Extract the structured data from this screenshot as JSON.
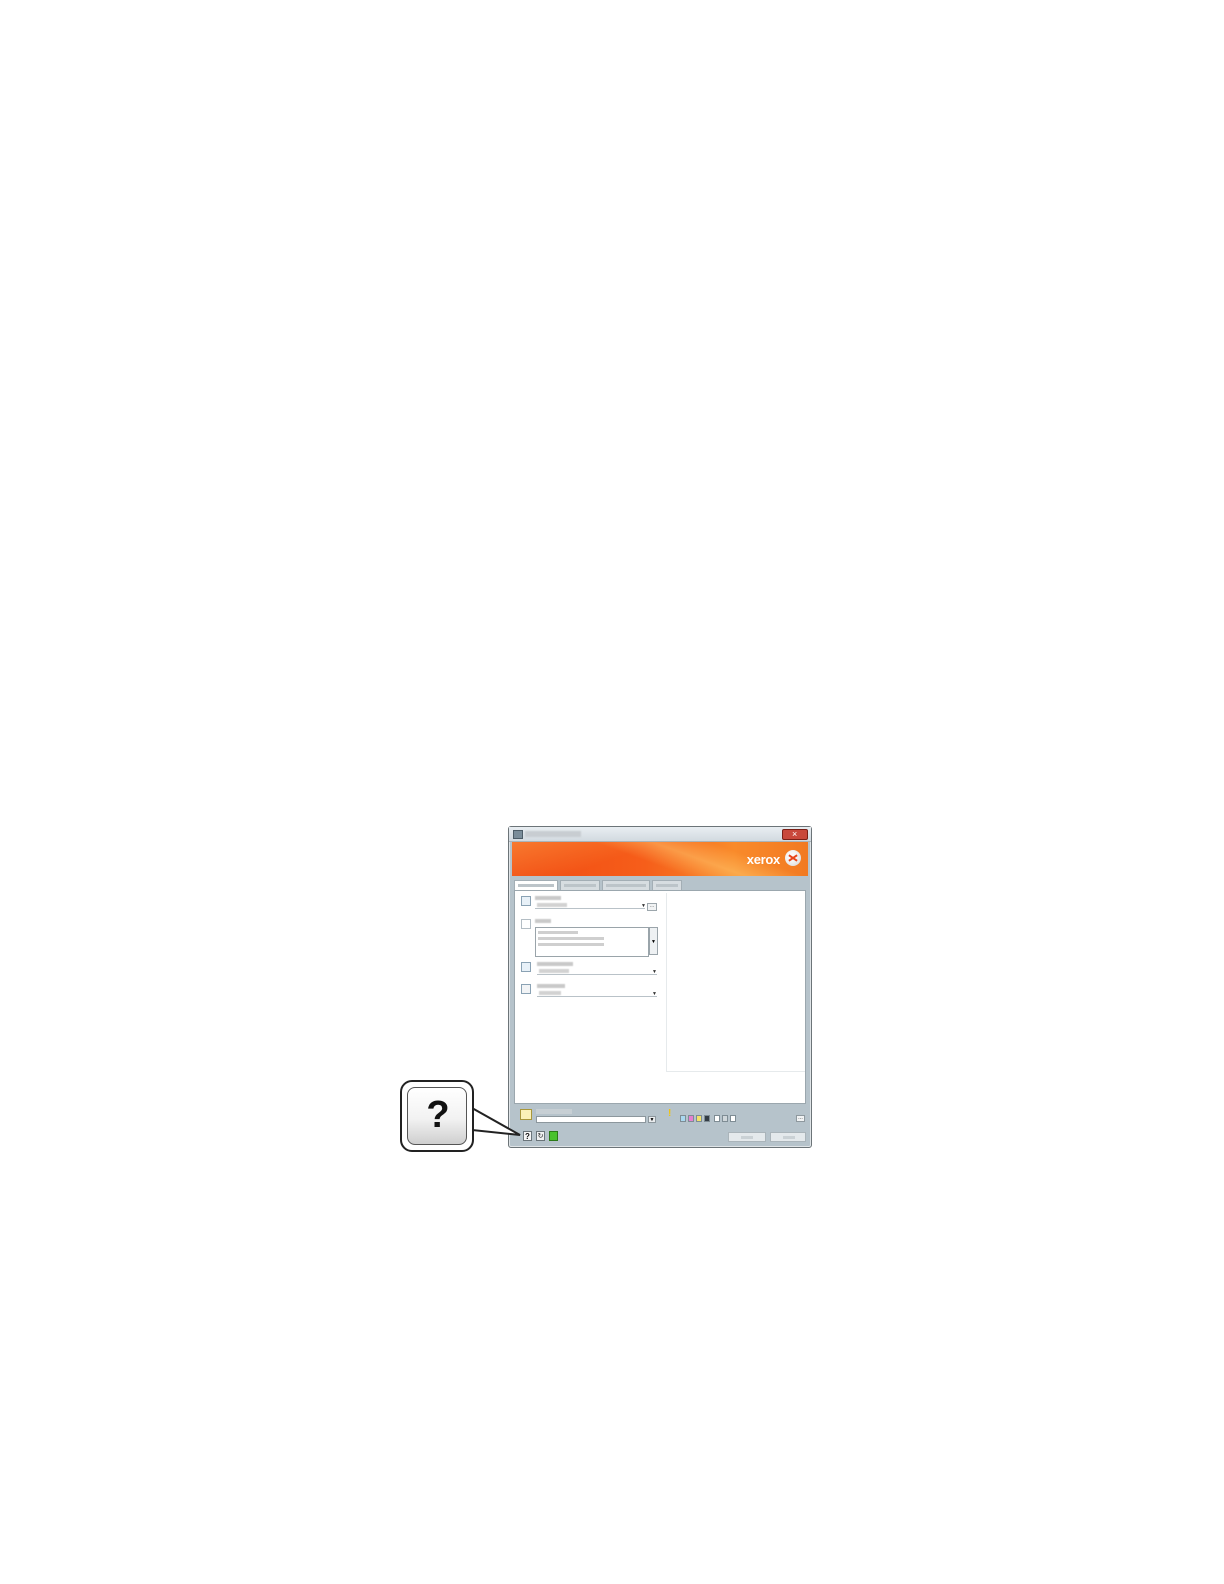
{
  "window": {
    "close_glyph": "×",
    "brand": "xerox",
    "brand_mark": "xerox-sphere-icon"
  },
  "bottom": {
    "warning_glyph": "!",
    "help_glyph": "?",
    "reset_glyph": "↻",
    "more_glyph": "…"
  },
  "callout": {
    "glyph": "?"
  },
  "colors": {
    "banner": "#f04a12",
    "window_frame": "#b6c3cb",
    "status_ok": "#49c22d"
  }
}
